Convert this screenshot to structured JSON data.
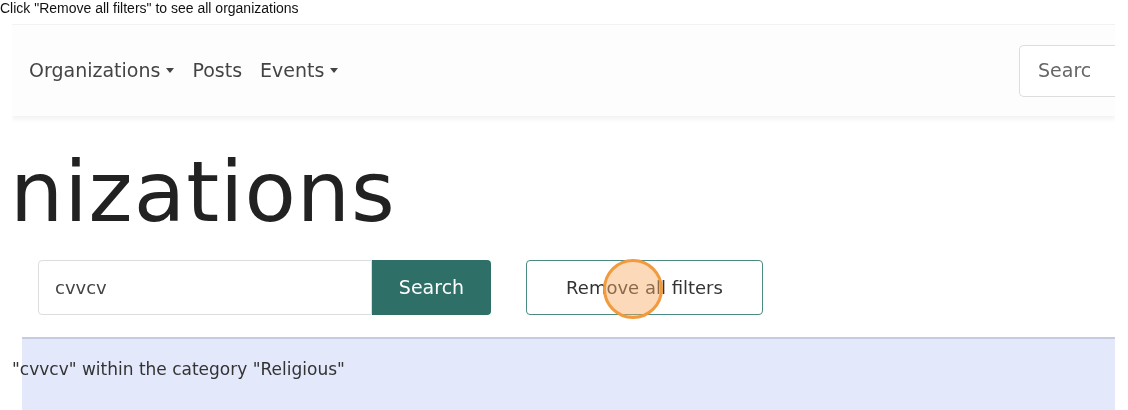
{
  "caption": "Click \"Remove all filters\" to see all organizations",
  "navbar": {
    "items": [
      {
        "label": "Organizations",
        "dropdown": true
      },
      {
        "label": "Posts",
        "dropdown": false
      },
      {
        "label": "Events",
        "dropdown": true
      }
    ],
    "search": {
      "placeholder": "Searc"
    }
  },
  "heading": "nizations",
  "search_form": {
    "value": "cvvcv",
    "button": "Search"
  },
  "remove_filters": {
    "label": "Remove all filters",
    "highlighted": true
  },
  "alert": "\"cvvcv\" within the category \"Religious\""
}
